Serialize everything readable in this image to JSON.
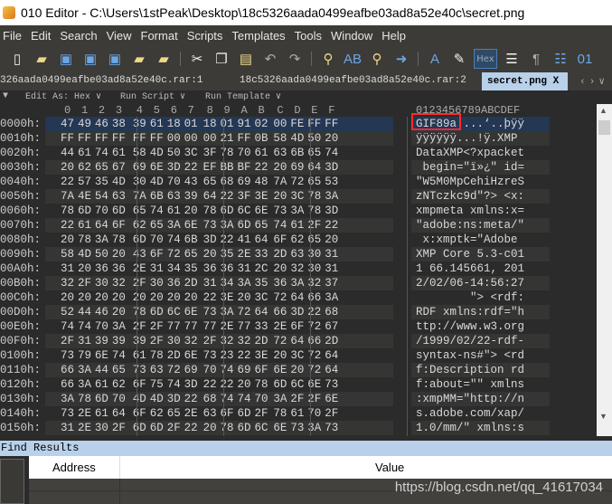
{
  "window": {
    "title": "010 Editor - C:\\Users\\1stPeak\\Desktop\\18c5326aada0499eafbe03ad8a52e40c\\secret.png"
  },
  "menu": [
    "File",
    "Edit",
    "Search",
    "View",
    "Format",
    "Scripts",
    "Templates",
    "Tools",
    "Window",
    "Help"
  ],
  "toolbar": {
    "hex_label": "Hex",
    "icons": [
      "new-file-icon",
      "open-folder-icon",
      "save-icon",
      "save-as-icon",
      "save-all-icon",
      "folder-icon",
      "multi-folder-icon",
      "cut-icon",
      "copy-icon",
      "paste-icon",
      "undo-icon",
      "redo-icon",
      "find-icon",
      "replace-icon",
      "find-in-files-icon",
      "goto-icon",
      "font-icon",
      "highlight-icon",
      "hex-mode-icon",
      "wrap-icon",
      "pilcrow-icon",
      "columns-icon",
      "binary-icon"
    ]
  },
  "tabs": [
    {
      "label": "326aada0499eafbe03ad8a52e40c.rar:1"
    },
    {
      "label": "18c5326aada0499eafbe03ad8a52e40c.rar:2"
    },
    {
      "label": "secret.png",
      "active": true,
      "close": "X"
    }
  ],
  "subbar": {
    "edit_as": "Edit As: Hex ∨",
    "run_script": "Run Script ∨",
    "run_template": "Run Template ∨"
  },
  "hex": {
    "column_headers": [
      "0",
      "1",
      "2",
      "3",
      "4",
      "5",
      "6",
      "7",
      "8",
      "9",
      "A",
      "B",
      "C",
      "D",
      "E",
      "F"
    ],
    "ascii_header": "0123456789ABCDEF",
    "highlight_text": "GIF89a",
    "rows": [
      {
        "addr": "0000h:",
        "bytes": "47 49 46 38 39 61 18 01 18 01 91 02 00 FE FF FF",
        "ascii": "GIF89a....‘..þÿÿ"
      },
      {
        "addr": "0010h:",
        "bytes": "FF FF FF FF FF FF 00 00 00 21 FF 0B 58 4D 50 20",
        "ascii": "ÿÿÿÿÿÿ...!ÿ.XMP "
      },
      {
        "addr": "0020h:",
        "bytes": "44 61 74 61 58 4D 50 3C 3F 78 70 61 63 6B 65 74",
        "ascii": "DataXMP<?xpacket"
      },
      {
        "addr": "0030h:",
        "bytes": "20 62 65 67 69 6E 3D 22 EF BB BF 22 20 69 64 3D",
        "ascii": " begin=\"ï»¿\" id="
      },
      {
        "addr": "0040h:",
        "bytes": "22 57 35 4D 30 4D 70 43 65 68 69 48 7A 72 65 53",
        "ascii": "\"W5M0MpCehiHzreS"
      },
      {
        "addr": "0050h:",
        "bytes": "7A 4E 54 63 7A 6B 63 39 64 22 3F 3E 20 3C 78 3A",
        "ascii": "zNTczkc9d\"?> <x:"
      },
      {
        "addr": "0060h:",
        "bytes": "78 6D 70 6D 65 74 61 20 78 6D 6C 6E 73 3A 78 3D",
        "ascii": "xmpmeta xmlns:x="
      },
      {
        "addr": "0070h:",
        "bytes": "22 61 64 6F 62 65 3A 6E 73 3A 6D 65 74 61 2F 22",
        "ascii": "\"adobe:ns:meta/\""
      },
      {
        "addr": "0080h:",
        "bytes": "20 78 3A 78 6D 70 74 6B 3D 22 41 64 6F 62 65 20",
        "ascii": " x:xmptk=\"Adobe "
      },
      {
        "addr": "0090h:",
        "bytes": "58 4D 50 20 43 6F 72 65 20 35 2E 33 2D 63 30 31",
        "ascii": "XMP Core 5.3-c01"
      },
      {
        "addr": "00A0h:",
        "bytes": "31 20 36 36 2E 31 34 35 36 36 31 2C 20 32 30 31",
        "ascii": "1 66.145661, 201"
      },
      {
        "addr": "00B0h:",
        "bytes": "32 2F 30 32 2F 30 36 2D 31 34 3A 35 36 3A 32 37",
        "ascii": "2/02/06-14:56:27"
      },
      {
        "addr": "00C0h:",
        "bytes": "20 20 20 20 20 20 20 20 22 3E 20 3C 72 64 66 3A",
        "ascii": "        \"> <rdf:"
      },
      {
        "addr": "00D0h:",
        "bytes": "52 44 46 20 78 6D 6C 6E 73 3A 72 64 66 3D 22 68",
        "ascii": "RDF xmlns:rdf=\"h"
      },
      {
        "addr": "00E0h:",
        "bytes": "74 74 70 3A 2F 2F 77 77 77 2E 77 33 2E 6F 72 67",
        "ascii": "ttp://www.w3.org"
      },
      {
        "addr": "00F0h:",
        "bytes": "2F 31 39 39 39 2F 30 32 2F 32 32 2D 72 64 66 2D",
        "ascii": "/1999/02/22-rdf-"
      },
      {
        "addr": "0100h:",
        "bytes": "73 79 6E 74 61 78 2D 6E 73 23 22 3E 20 3C 72 64",
        "ascii": "syntax-ns#\"> <rd"
      },
      {
        "addr": "0110h:",
        "bytes": "66 3A 44 65 73 63 72 69 70 74 69 6F 6E 20 72 64",
        "ascii": "f:Description rd"
      },
      {
        "addr": "0120h:",
        "bytes": "66 3A 61 62 6F 75 74 3D 22 22 20 78 6D 6C 6E 73",
        "ascii": "f:about=\"\" xmlns"
      },
      {
        "addr": "0130h:",
        "bytes": "3A 78 6D 70 4D 4D 3D 22 68 74 74 70 3A 2F 2F 6E",
        "ascii": ":xmpMM=\"http://n"
      },
      {
        "addr": "0140h:",
        "bytes": "73 2E 61 64 6F 62 65 2E 63 6F 6D 2F 78 61 70 2F",
        "ascii": "s.adobe.com/xap/"
      },
      {
        "addr": "0150h:",
        "bytes": "31 2E 30 2F 6D 6D 2F 22 20 78 6D 6C 6E 73 3A 73",
        "ascii": "1.0/mm/\" xmlns:s"
      }
    ]
  },
  "find_results": {
    "title": "Find Results",
    "columns": [
      "Address",
      "Value"
    ]
  },
  "watermark": "https://blog.csdn.net/qq_41617034"
}
